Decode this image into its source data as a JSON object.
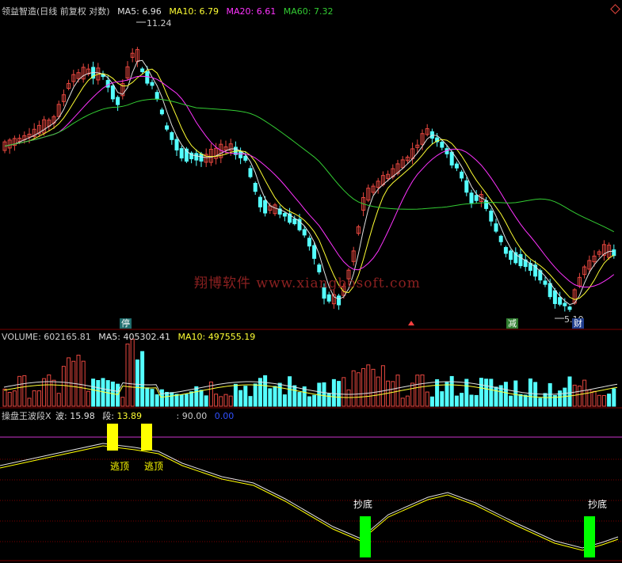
{
  "colors": {
    "up": "#e8473f",
    "down": "#54ffff",
    "ma5": "#e0e0e0",
    "ma10": "#ffff33",
    "ma20": "#ff33ff",
    "ma60": "#33cc33",
    "grid": "#7a0000",
    "signal_top": "#ffff00",
    "signal_bottom": "#00ff00"
  },
  "main": {
    "title": "领益智造(日线 前复权 对数)",
    "ma5": {
      "label": "MA5:",
      "value": "6.96"
    },
    "ma10": {
      "label": "MA10:",
      "value": "6.79"
    },
    "ma20": {
      "label": "MA20:",
      "value": "6.61"
    },
    "ma60": {
      "label": "MA60:",
      "value": "7.32"
    },
    "high_label": "11.24",
    "low_label": "5.10",
    "badge_ting": "停",
    "badge_jian": "减",
    "badge_cai": "财",
    "watermark": "翔博软件 www.xiangbosoft.com",
    "corner_icon": "diamond-icon"
  },
  "volume": {
    "title": "VOLUME:",
    "title_value": "602165.81",
    "ma5": {
      "label": "MA5:",
      "value": "405302.41"
    },
    "ma10": {
      "label": "MA10:",
      "value": "497555.19"
    }
  },
  "indicator": {
    "title": "操盘王波段X",
    "wave": {
      "label": "波:",
      "value": "15.98"
    },
    "segment": {
      "label": "段:",
      "value": "13.89"
    },
    "level": {
      "label": ":",
      "value": "90.00"
    },
    "zero": "0.00",
    "signal_top_1": "逃顶",
    "signal_top_2": "逃顶",
    "signal_bottom_1": "抄底",
    "signal_bottom_2": "抄底"
  }
}
